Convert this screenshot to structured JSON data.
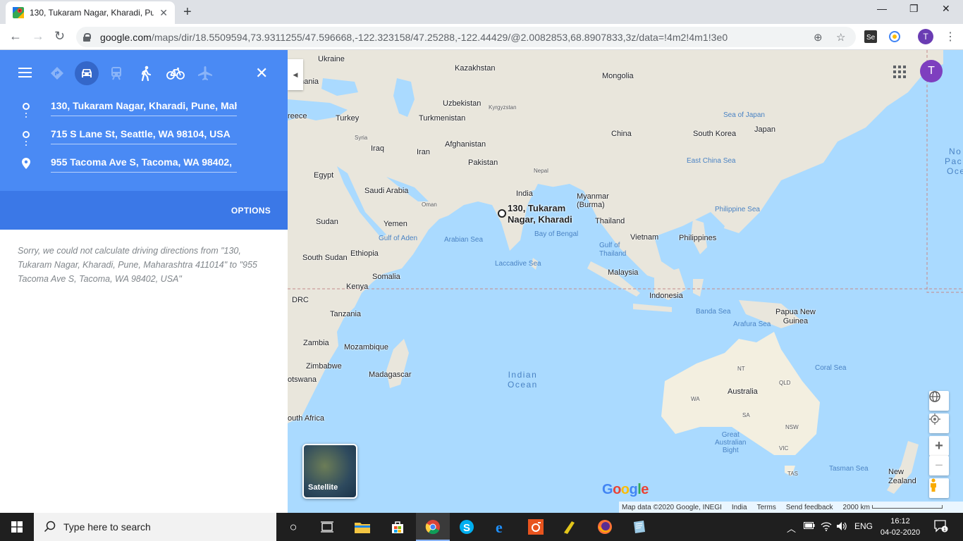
{
  "browser": {
    "tab_title": "130, Tukaram Nagar, Kharadi, Pu",
    "url_host": "google.com",
    "url_path": "/maps/dir/18.5509594,73.9311255/47.596668,-122.323158/47.25288,-122.44429/@2.0082853,68.8907833,3z/data=!4m2!4m1!3e0",
    "profile_initial": "T"
  },
  "directions": {
    "stops": [
      "130, Tukaram Nagar, Kharadi, Pune, Mah",
      "715 S Lane St, Seattle, WA 98104, USA",
      "955 Tacoma Ave S, Tacoma, WA 98402,"
    ],
    "options_label": "OPTIONS",
    "error": "Sorry, we could not calculate driving directions from \"130, Tukaram Nagar, Kharadi, Pune, Maharashtra 411014\" to \"955 Tacoma Ave S, Tacoma, WA 98402, USA\""
  },
  "map": {
    "marker_label_line1": "130, Tukaram",
    "marker_label_line2": "Nagar, Kharadi",
    "satellite_label": "Satellite",
    "profile_initial": "T",
    "logo": "Google",
    "footer": {
      "data": "Map data ©2020 Google, INEGI",
      "country": "India",
      "terms": "Terms",
      "feedback": "Send feedback",
      "scale": "2000 km"
    },
    "labels": {
      "ukraine": "Ukraine",
      "kazakhstan": "Kazakhstan",
      "mongolia": "Mongolia",
      "romania": "Romania",
      "uzbekistan": "Uzbekistan",
      "kyrgyzstan": "Kyrgyzstan",
      "greece": "reece",
      "turkey": "Turkey",
      "turkmenistan": "Turkmenistan",
      "syria": "Syria",
      "iraq": "Iraq",
      "iran": "Iran",
      "afghanistan": "Afghanistan",
      "pakistan": "Pakistan",
      "nepal": "Nepal",
      "china": "China",
      "south_korea": "South Korea",
      "japan": "Japan",
      "sea_of_japan": "Sea of Japan",
      "east_china_sea": "East China Sea",
      "north_pacific": "No",
      "pacific2": "Pac",
      "pacific3": "Oce",
      "egypt": "Egypt",
      "saudi": "Saudi Arabia",
      "oman": "Oman",
      "india": "India",
      "myanmar": "Myanmar\n(Burma)",
      "thailand": "Thailand",
      "philippine_sea": "Philippine Sea",
      "sudan": "Sudan",
      "yemen": "Yemen",
      "gulf_aden": "Gulf of Aden",
      "arabian_sea": "Arabian Sea",
      "bay_bengal": "Bay of Bengal",
      "gulf_thailand": "Gulf of\nThailand",
      "vietnam": "Vietnam",
      "philippines": "Philippines",
      "south_sudan": "South Sudan",
      "ethiopia": "Ethiopia",
      "laccadive": "Laccadive Sea",
      "malaysia": "Malaysia",
      "somalia": "Somalia",
      "kenya": "Kenya",
      "drc": "DRC",
      "indonesia": "Indonesia",
      "banda": "Banda Sea",
      "png": "Papua New\nGuinea",
      "arafura": "Arafura Sea",
      "tanzania": "Tanzania",
      "zambia": "Zambia",
      "mozambique": "Mozambique",
      "zimbabwe": "Zimbabwe",
      "madagascar": "Madagascar",
      "indian_ocean": "Indian\nOcean",
      "botswana": "otswana",
      "south_africa": "outh Africa",
      "nt": "NT",
      "qld": "QLD",
      "coral": "Coral Sea",
      "australia": "Australia",
      "wa": "WA",
      "sa": "SA",
      "nsw": "NSW",
      "gab": "Great\nAustralian\nBight",
      "vic": "VIC",
      "tas": "TAS",
      "tasman": "Tasman Sea",
      "nz": "New\nZealand"
    }
  },
  "taskbar": {
    "search_placeholder": "Type here to search",
    "lang": "ENG",
    "time": "16:12",
    "date": "04-02-2020",
    "notif_count": "1"
  }
}
